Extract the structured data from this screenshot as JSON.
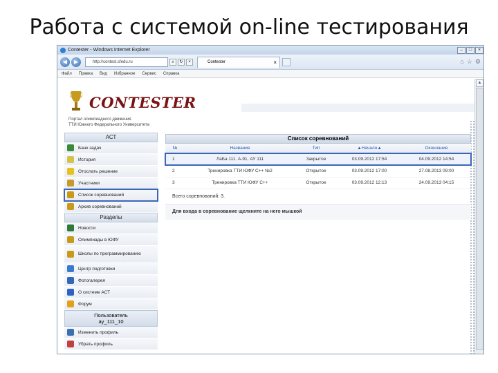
{
  "slide_title": "Работа с системой on-line тестирования",
  "browser": {
    "window_title": "Contester - Windows Internet Explorer",
    "address": "http://contest.sfedu.ru",
    "tab_label": "Contester",
    "menu": [
      "Файл",
      "Правка",
      "Вид",
      "Избранное",
      "Сервис",
      "Справка"
    ]
  },
  "site": {
    "logo": "CONTESTER",
    "portal_line1": "Портал олимпиадного движения",
    "portal_line2": "ТТИ Южного Федерального Университета"
  },
  "sidebar": {
    "act_header": "АСТ",
    "act_items": [
      {
        "label": "Банк задач",
        "icon": "tasks-icon",
        "color": "#3a8a3a"
      },
      {
        "label": "История",
        "icon": "history-icon",
        "color": "#d4c24a"
      },
      {
        "label": "Отослать решение",
        "icon": "bulb-icon",
        "color": "#e6c21c"
      },
      {
        "label": "Участники",
        "icon": "participants-icon",
        "color": "#c79a2a"
      },
      {
        "label": "Список соревнований",
        "icon": "trophy-icon",
        "color": "#c89a1a"
      },
      {
        "label": "Архив соревнований",
        "icon": "archive-trophy-icon",
        "color": "#c89a1a"
      }
    ],
    "sections_header": "Разделы",
    "section_items": [
      {
        "label": "Новости",
        "icon": "globe-icon",
        "color": "#2d7a3a"
      },
      {
        "label": "Олимпиады в ЮФУ",
        "icon": "trophy-icon",
        "color": "#c89a1a"
      },
      {
        "label": "Школы по программированию",
        "icon": "trophy-icon",
        "color": "#c89a1a",
        "tall": true
      },
      {
        "label": "Центр подготовки",
        "icon": "training-icon",
        "color": "#3b7ad0"
      },
      {
        "label": "Фотогалерея",
        "icon": "camera-icon",
        "color": "#3467b8"
      },
      {
        "label": "О системе АСТ",
        "icon": "help-icon",
        "color": "#2f62c0"
      },
      {
        "label": "Форум",
        "icon": "forum-icon",
        "color": "#e0a21c"
      }
    ],
    "user_header": "Пользователь",
    "user_name": "ay_111_10",
    "user_items": [
      {
        "label": "Изменить профиль",
        "icon": "profile-icon",
        "color": "#3a6fb0"
      },
      {
        "label": "Убрать профиль",
        "icon": "logout-icon",
        "color": "#c04040"
      }
    ]
  },
  "competitions": {
    "title": "Список соревнований",
    "columns": [
      "№",
      "Название",
      "Тип",
      "▲Начало▲",
      "Окончание"
    ],
    "rows": [
      {
        "num": "1",
        "name": "ЛаБа 111. А-91. АУ 111",
        "type": "Закрытое",
        "start": "03.09.2012 17:54",
        "end": "04.09.2012 14:54"
      },
      {
        "num": "2",
        "name": "Тренировка ТТИ ЮФУ С++ №2",
        "type": "Открытое",
        "start": "03.09.2012 17:00",
        "end": "27.08.2013 09:00"
      },
      {
        "num": "3",
        "name": "Тренировка ТТИ ЮФУ С++",
        "type": "Открытое",
        "start": "03.09.2012 12:13",
        "end": "24.09.2013 04:15"
      }
    ],
    "total": "Всего соревнований: 3.",
    "hint": "Для входа в соревнование щелкните на него мышкой"
  }
}
